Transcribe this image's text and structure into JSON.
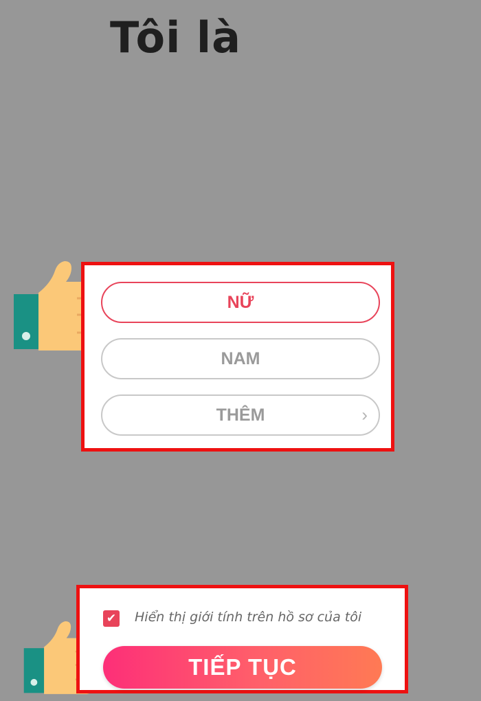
{
  "title": "Tôi là",
  "gender_options": [
    {
      "label": "NỮ",
      "selected": true
    },
    {
      "label": "NAM",
      "selected": false
    },
    {
      "label": "THÊM",
      "selected": false
    }
  ],
  "more_chevron": "›",
  "show_gender": {
    "checked": true,
    "label": "Hiển thị giới tính trên hồ sơ của tôi"
  },
  "continue_label": "TIẾP TỤC",
  "colors": {
    "accent": "#e8445a",
    "highlight_box": "#ee1111",
    "gradient_start": "#fd2f78",
    "gradient_end": "#ff7a54",
    "overlay": "#979797"
  },
  "icons": {
    "pointer": "hand-pointer-icon",
    "check": "checkmark-icon",
    "chevron": "chevron-right-icon"
  }
}
